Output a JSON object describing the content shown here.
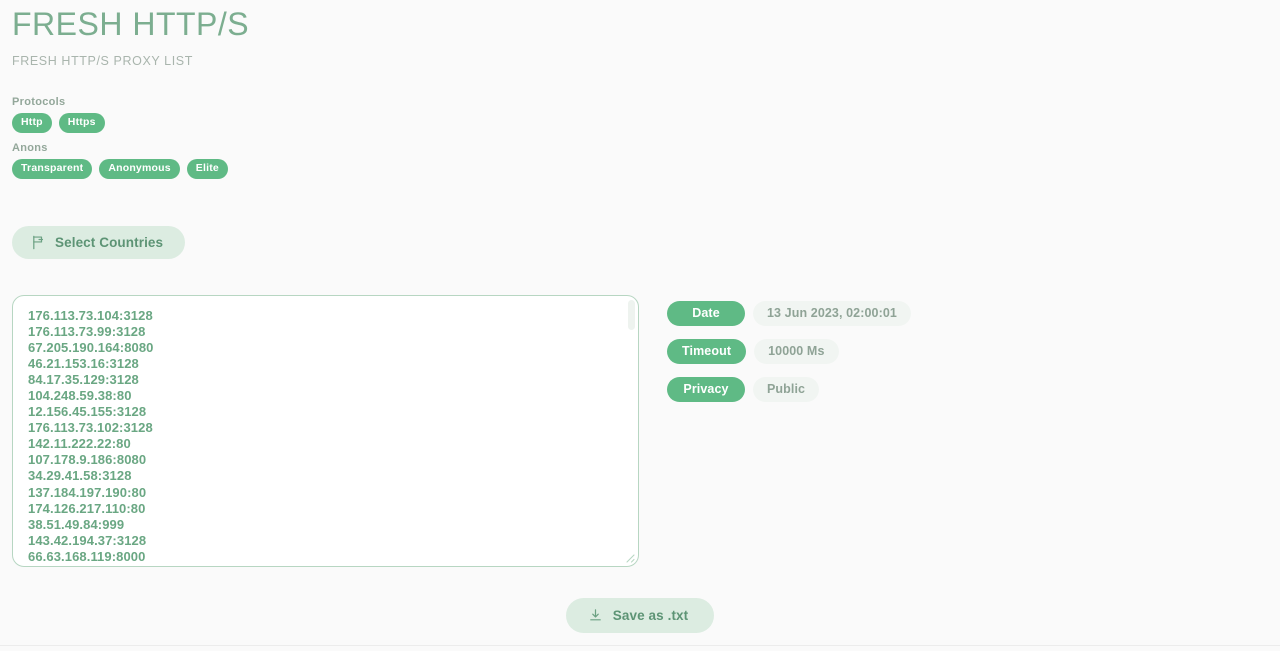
{
  "header": {
    "title": "FRESH HTTP/S",
    "subtitle": "FRESH HTTP/S PROXY LIST"
  },
  "filters": {
    "protocols_label": "Protocols",
    "protocols": [
      {
        "label": "Http"
      },
      {
        "label": "Https"
      }
    ],
    "anons_label": "Anons",
    "anons": [
      {
        "label": "Transparent"
      },
      {
        "label": "Anonymous"
      },
      {
        "label": "Elite"
      }
    ]
  },
  "countries": {
    "button_label": "Select Countries",
    "icon": "flag-icon"
  },
  "proxy_list": [
    "176.113.73.104:3128",
    "176.113.73.99:3128",
    "67.205.190.164:8080",
    "46.21.153.16:3128",
    "84.17.35.129:3128",
    "104.248.59.38:80",
    "12.156.45.155:3128",
    "176.113.73.102:3128",
    "142.11.222.22:80",
    "107.178.9.186:8080",
    "34.29.41.58:3128",
    "137.184.197.190:80",
    "174.126.217.110:80",
    "38.51.49.84:999",
    "143.42.194.37:3128",
    "66.63.168.119:8000"
  ],
  "info": [
    {
      "key": "Date",
      "value": "13 Jun 2023, 02:00:01"
    },
    {
      "key": "Timeout",
      "value": "10000 Ms"
    },
    {
      "key": "Privacy",
      "value": "Public"
    }
  ],
  "footer": {
    "save_label": "Save as .txt",
    "icon": "download-icon"
  },
  "colors": {
    "background": "#fafafa",
    "accent_green": "#5fba85",
    "title_green": "#7cae90",
    "soft_green_bg": "#dcece1",
    "list_text": "#6aa783",
    "value_bg": "#f1f5f2",
    "value_text": "#8fa396",
    "border_green": "#b7d6c2"
  }
}
